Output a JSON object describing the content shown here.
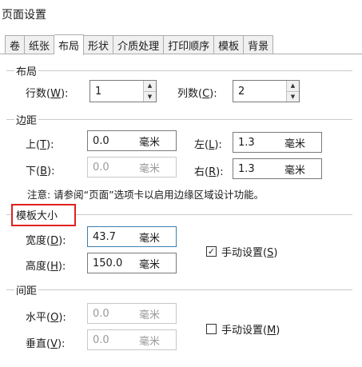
{
  "window": {
    "title": "页面设置"
  },
  "tabs": [
    {
      "label": "卷"
    },
    {
      "label": "纸张"
    },
    {
      "label": "布局"
    },
    {
      "label": "形状"
    },
    {
      "label": "介质处理"
    },
    {
      "label": "打印顺序"
    },
    {
      "label": "模板"
    },
    {
      "label": "背景"
    }
  ],
  "layout_group": {
    "title": "布局",
    "rows": {
      "label": "行数(",
      "key": "W",
      "close": "):",
      "value": "1"
    },
    "cols": {
      "label": "列数(",
      "key": "C",
      "close": "):",
      "value": "2"
    }
  },
  "margin_group": {
    "title": "边距",
    "top": {
      "label": "上(",
      "key": "T",
      "close": "):",
      "value": "0.0",
      "unit": "毫米"
    },
    "bottom": {
      "label": "下(",
      "key": "B",
      "close": "):",
      "value": "0.0",
      "unit": "毫米"
    },
    "left": {
      "label": "左(",
      "key": "L",
      "close": "):",
      "value": "1.3",
      "unit": "毫米"
    },
    "right": {
      "label": "右(",
      "key": "R",
      "close": "):",
      "value": "1.3",
      "unit": "毫米"
    },
    "note": "注意: 请参阅“页面”选项卡以启用边缘区域设计功能。"
  },
  "template_size_group": {
    "title": "模板大小",
    "width": {
      "label": "宽度(",
      "key": "D",
      "close": "):",
      "value": "43.7",
      "unit": "毫米"
    },
    "height": {
      "label": "高度(",
      "key": "H",
      "close": "):",
      "value": "150.0",
      "unit": "毫米"
    },
    "manual": {
      "label": "手动设置(",
      "key": "S",
      "close": ")",
      "checked": true
    }
  },
  "spacing_group": {
    "title": "间距",
    "horizontal": {
      "label": "水平(",
      "key": "O",
      "close": "):",
      "value": "0.0",
      "unit": "毫米"
    },
    "vertical": {
      "label": "垂直(",
      "key": "V",
      "close": "):",
      "value": "0.0",
      "unit": "毫米"
    },
    "manual": {
      "label": "手动设置(",
      "key": "M",
      "close": ")",
      "checked": false
    }
  },
  "icons": {
    "spin_up": "▲",
    "spin_down": "▼",
    "check": "✓"
  },
  "colors": {
    "highlight_box": "#e02020",
    "focus_border": "#3c7fb1"
  }
}
